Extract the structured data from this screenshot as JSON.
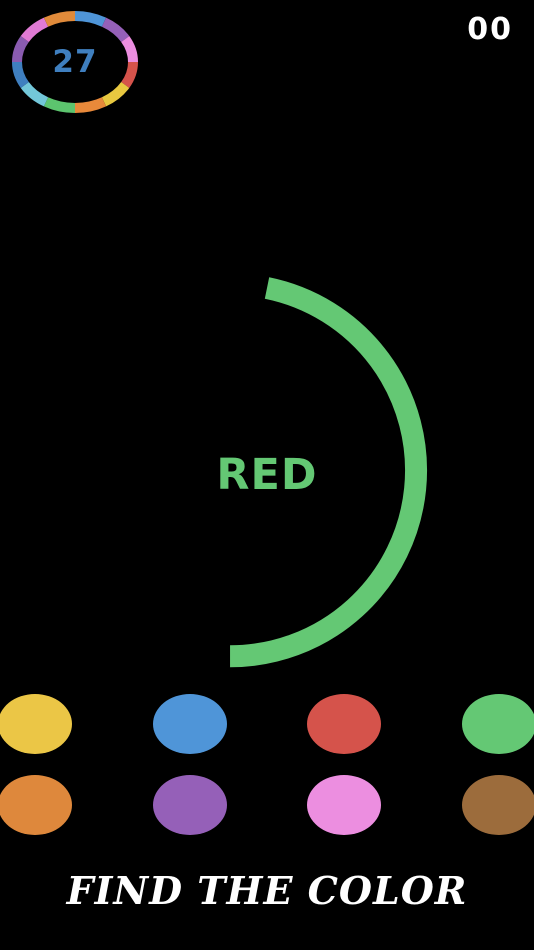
{
  "timer": {
    "value": "27",
    "ring_icon": "rainbow-ring-icon",
    "ring_colors": [
      "#4f95d8",
      "#9560b8",
      "#ec8ee0",
      "#d5534b",
      "#e8c840",
      "#e8893a",
      "#5cc46e",
      "#73c7d9",
      "#3f7fbf",
      "#8a5bb0",
      "#e07ad4",
      "#e08a3a"
    ]
  },
  "score": {
    "value": "00"
  },
  "prompt": {
    "word": "RED",
    "word_color": "#64c874",
    "arc_color": "#64c874"
  },
  "swatches": [
    {
      "name": "yellow",
      "color": "#ebc646"
    },
    {
      "name": "blue",
      "color": "#4f95d8"
    },
    {
      "name": "red",
      "color": "#d5534b"
    },
    {
      "name": "green",
      "color": "#64c874"
    },
    {
      "name": "orange",
      "color": "#de883c"
    },
    {
      "name": "purple",
      "color": "#9560b8"
    },
    {
      "name": "pink",
      "color": "#ec8ee0"
    },
    {
      "name": "brown",
      "color": "#9c6c3c"
    }
  ],
  "footer": {
    "title": "FIND THE COLOR"
  }
}
